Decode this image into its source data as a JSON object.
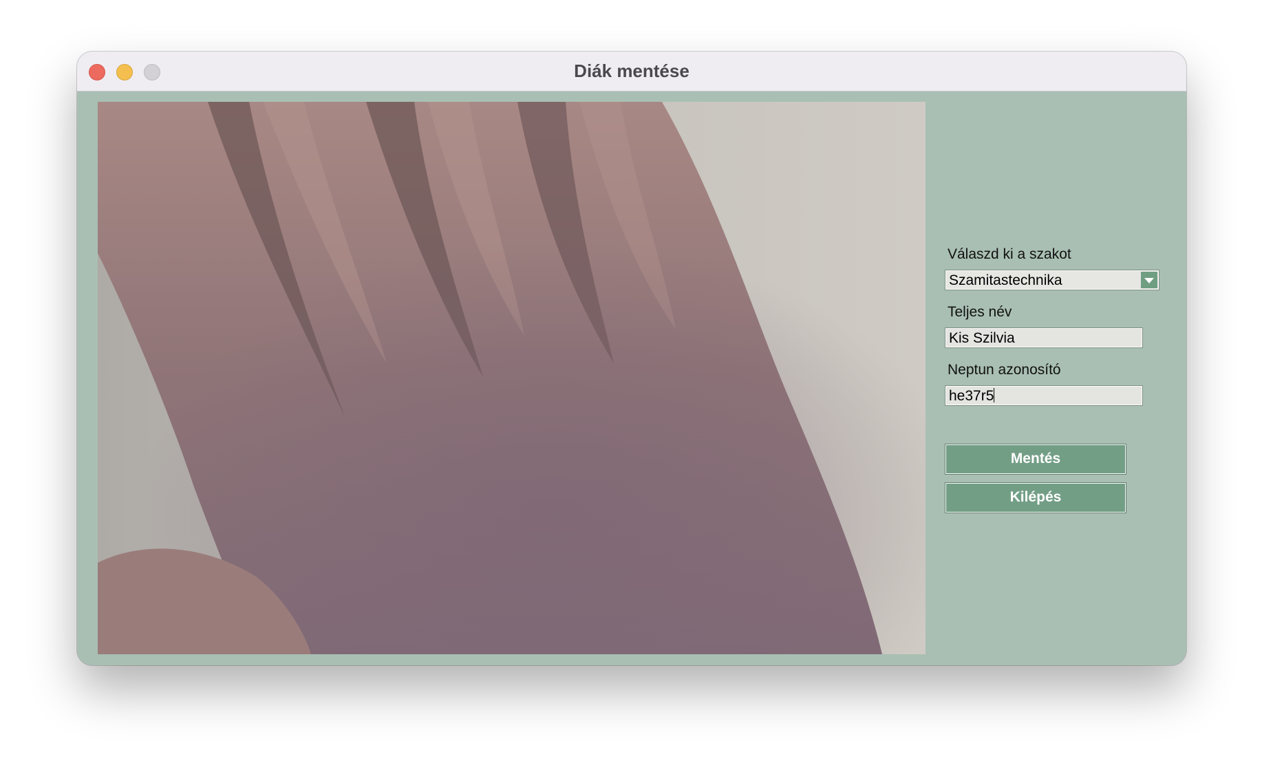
{
  "window": {
    "title": "Diák mentése"
  },
  "titlebar": {
    "buttons": [
      "close",
      "minimize",
      "zoom"
    ]
  },
  "form": {
    "major_label": "Válaszd ki a szakot",
    "major_selected": "Szamitastechnika",
    "fullname_label": "Teljes név",
    "fullname_value": "Kis Szilvia",
    "neptun_label": "Neptun azonosító",
    "neptun_value": "he37r5"
  },
  "buttons": {
    "save_label": "Mentés",
    "exit_label": "Kilépés"
  },
  "colors": {
    "window_background": "#a9bfb3",
    "button_background": "#739e86",
    "dropdown_arrow": "#6f9e82"
  }
}
